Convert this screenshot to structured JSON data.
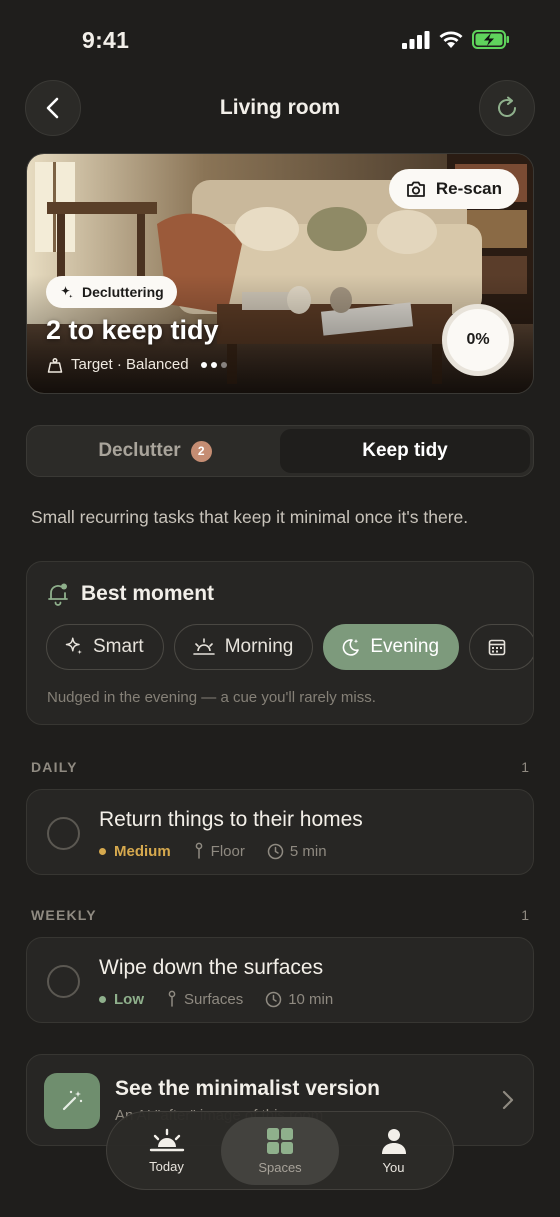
{
  "status_bar": {
    "time": "9:41"
  },
  "header": {
    "title": "Living room"
  },
  "hero": {
    "rescan_label": "Re-scan",
    "mode_badge": "Decluttering",
    "title": "2 to keep tidy",
    "subtitle": "Target · Balanced",
    "progress_label": "0%",
    "progress_value": 0
  },
  "tabs": {
    "declutter_label": "Declutter",
    "declutter_count": "2",
    "keep_tidy_label": "Keep tidy",
    "active": "Keep tidy"
  },
  "intro_text": "Small recurring tasks that keep it minimal once it's there.",
  "best_moment": {
    "title": "Best moment",
    "options": [
      {
        "label": "Smart",
        "icon": "sparkle-icon"
      },
      {
        "label": "Morning",
        "icon": "sunrise-icon"
      },
      {
        "label": "Evening",
        "icon": "moon-stars-icon"
      },
      {
        "label": "",
        "icon": "calendar-icon"
      }
    ],
    "selected": "Evening",
    "note": "Nudged in the evening — a cue you'll rarely miss."
  },
  "sections": [
    {
      "label": "DAILY",
      "count": "1",
      "tasks": [
        {
          "title": "Return things to their homes",
          "priority": "Medium",
          "priority_color": "#d6a94e",
          "area": "Floor",
          "duration": "5 min"
        }
      ]
    },
    {
      "label": "WEEKLY",
      "count": "1",
      "tasks": [
        {
          "title": "Wipe down the surfaces",
          "priority": "Low",
          "priority_color": "#8fb08c",
          "area": "Surfaces",
          "duration": "10 min"
        }
      ]
    }
  ],
  "promo": {
    "title": "See the minimalist version",
    "subtitle": "An AI \"after\" image of this room",
    "icon": "magic-wand-icon"
  },
  "tab_bar": {
    "items": [
      {
        "label": "Today",
        "icon": "sunrise-icon"
      },
      {
        "label": "Spaces",
        "icon": "grid-icon"
      },
      {
        "label": "You",
        "icon": "person-icon"
      }
    ],
    "active": "Spaces"
  },
  "colors": {
    "background": "#1f1e1c",
    "card": "#272624",
    "accent_green": "#7d9a7c",
    "badge_terracotta": "#c58d73"
  }
}
